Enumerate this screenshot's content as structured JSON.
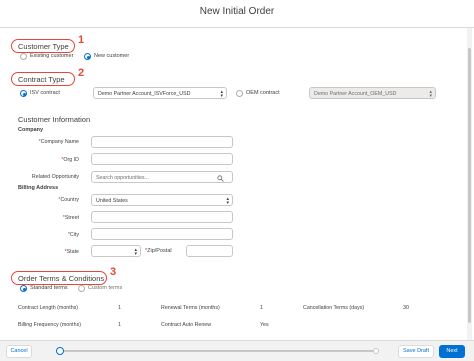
{
  "modal": {
    "title": "New Initial Order"
  },
  "customer_type": {
    "heading": "Customer Type",
    "marker": "1",
    "options": [
      {
        "label": "Existing customer",
        "selected": false
      },
      {
        "label": "New customer",
        "selected": true
      }
    ]
  },
  "contract_type": {
    "heading": "Contract Type",
    "marker": "2",
    "isv_label": "ISV contract",
    "isv_selected": true,
    "isv_account": "Demo Partner Account_ISVForce_USD",
    "oem_label": "OEM contract",
    "oem_selected": false,
    "oem_account": "Demo Partner Account_OEM_USD"
  },
  "customer_info": {
    "heading": "Customer Information",
    "company_section": "Company",
    "company_name_label": "Company Name",
    "org_id_label": "Org ID",
    "related_opportunity_label": "Related Opportunity",
    "related_opportunity_placeholder": "Search opportunities...",
    "billing_section": "Billing Address",
    "country_label": "Country",
    "country_value": "United States",
    "street_label": "Street",
    "city_label": "City",
    "state_label": "State",
    "zip_label": "Zip/Postal",
    "required_mark": "*"
  },
  "order_terms": {
    "heading": "Order Terms & Conditions",
    "marker": "3",
    "options": [
      {
        "label": "Standard terms",
        "selected": true
      },
      {
        "label": "Custom terms",
        "selected": false
      }
    ],
    "rows": [
      [
        {
          "label": "Contract Length (months)",
          "value": "1"
        },
        {
          "label": "Renewal Terms (months)",
          "value": "1"
        },
        {
          "label": "Cancellation Terms (days)",
          "value": "30"
        }
      ],
      [
        {
          "label": "Billing Frequency (months)",
          "value": "1"
        },
        {
          "label": "Contract Auto Renew",
          "value": "Yes"
        }
      ]
    ]
  },
  "footer": {
    "cancel_label": "Cancel",
    "save_draft_label": "Save Draft",
    "next_label": "Next",
    "progress_fraction": 0.0
  },
  "colors": {
    "accent": "#0070d2",
    "annotation": "#e5473a"
  }
}
